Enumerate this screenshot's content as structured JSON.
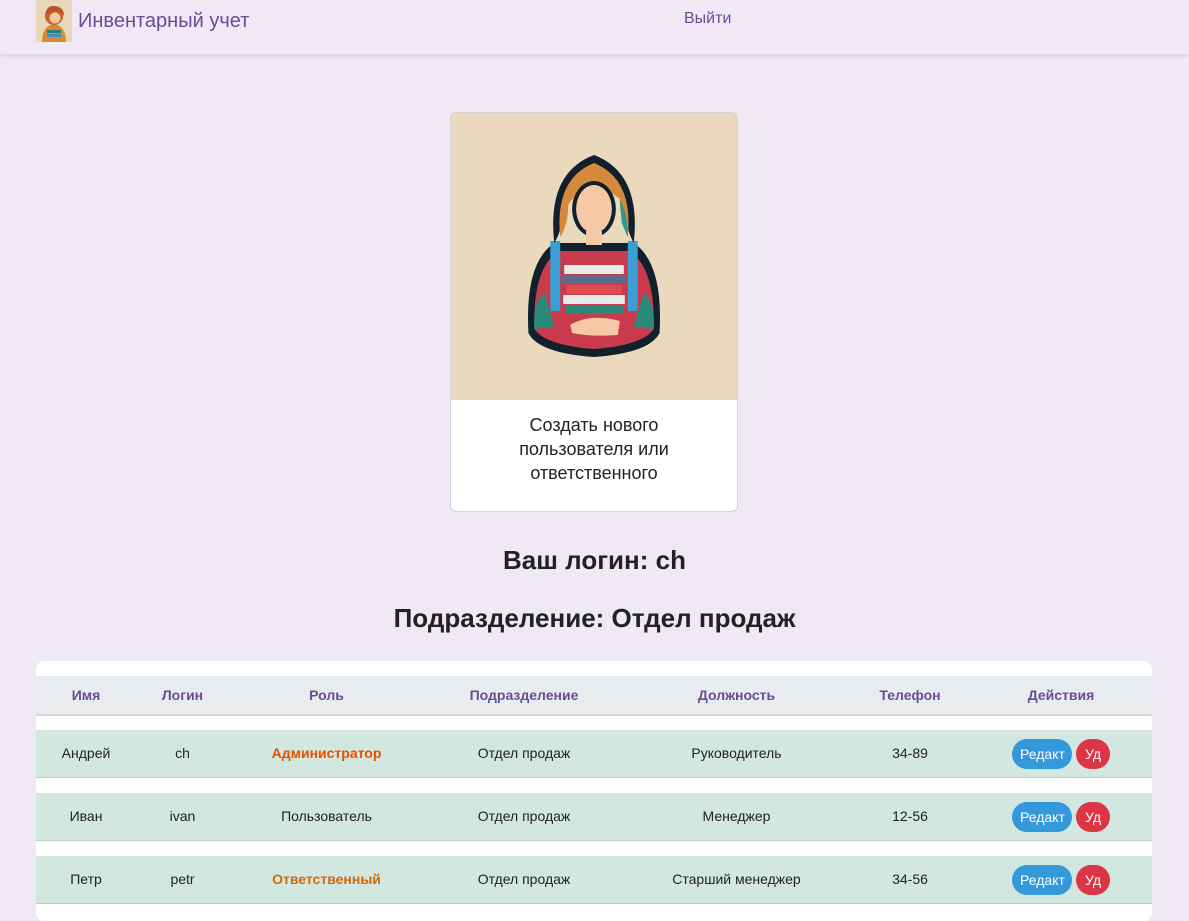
{
  "navbar": {
    "brand_text": "Инвентарный учет",
    "logout_label": "Выйти"
  },
  "card": {
    "image_icon": "person-with-books-illustration",
    "text": "Создать нового пользователя или ответственного"
  },
  "login_line": "Ваш логин: ch",
  "department_line": "Подразделение: Отдел продаж",
  "table": {
    "headers": [
      "Имя",
      "Логин",
      "Роль",
      "Подразделение",
      "Должность",
      "Телефон",
      "Действия"
    ],
    "rows": [
      {
        "name": "Андрей",
        "login": "ch",
        "role": "Администратор",
        "department": "Отдел продаж",
        "position": "Руководитель",
        "phone": "34-89"
      },
      {
        "name": "Иван",
        "login": "ivan",
        "role": "Пользователь",
        "department": "Отдел продаж",
        "position": "Менеджер",
        "phone": "12-56"
      },
      {
        "name": "Петр",
        "login": "petr",
        "role": "Ответственный",
        "department": "Отдел продаж",
        "position": "Старший менеджер",
        "phone": "34-56"
      }
    ],
    "edit_label": "Редакт",
    "delete_label": "Уд"
  },
  "colors": {
    "accent": "#6a4c93",
    "page_bg": "#efe8f5",
    "row_bg": "#d1e7df",
    "edit_button": "#3399db",
    "delete_button": "#dc3545",
    "role_admin": "#e65100",
    "role_responsible": "#d4690a"
  }
}
